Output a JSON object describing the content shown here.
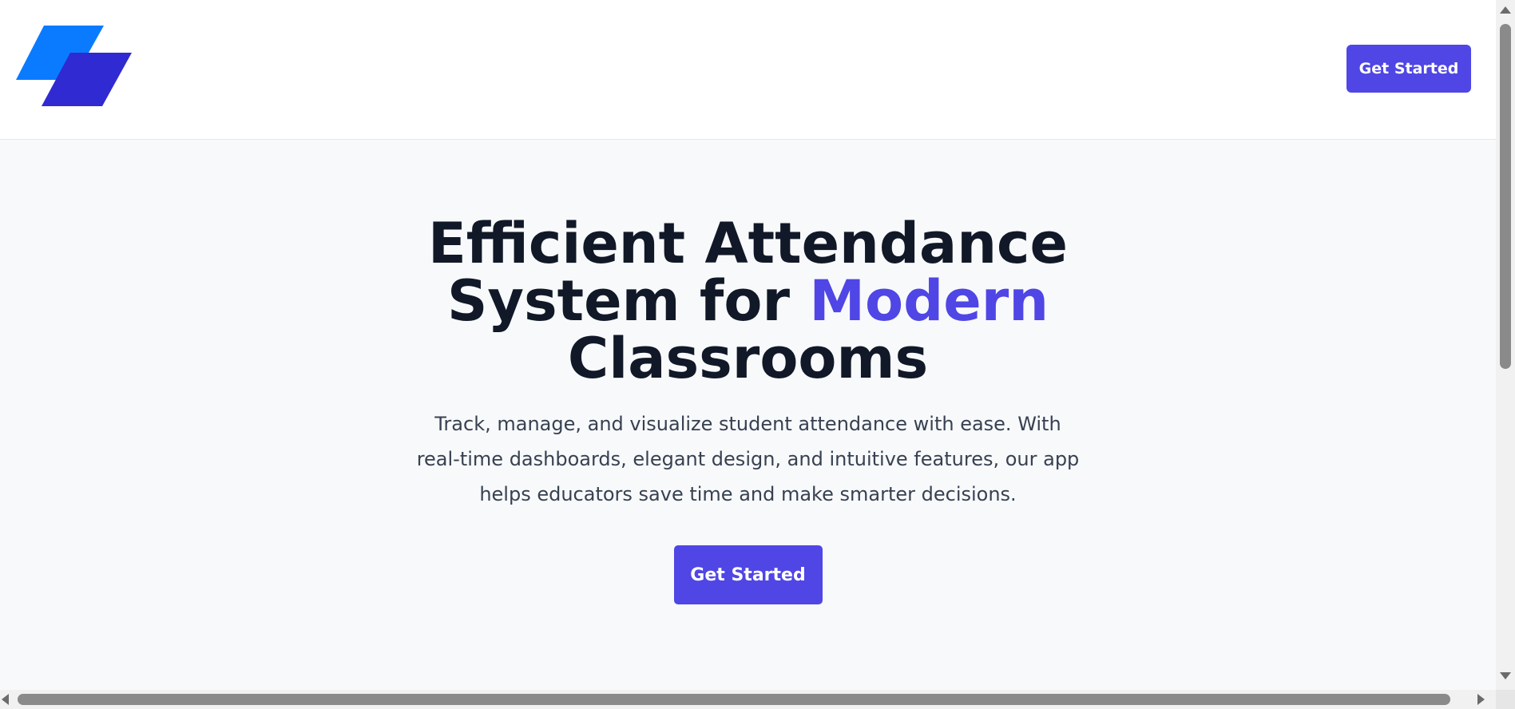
{
  "header": {
    "logo_icon": "brand-logo-icon",
    "cta_label": "Get Started"
  },
  "hero": {
    "title_line1": "Efficient Attendance",
    "title_line2_prefix": "System for ",
    "title_line2_accent": "Modern",
    "title_line3": "Classrooms",
    "description": "Track, manage, and visualize student attendance with ease. With real-time dashboards, elegant design, and intuitive features, our app helps educators save time and make smarter decisions.",
    "cta_label": "Get Started"
  },
  "colors": {
    "accent": "#4f46e5",
    "logo_light": "#0a7bff",
    "logo_dark": "#2f2ad1",
    "heading": "#111827",
    "body_text": "#374151",
    "page_bg": "#f8f9fb"
  }
}
